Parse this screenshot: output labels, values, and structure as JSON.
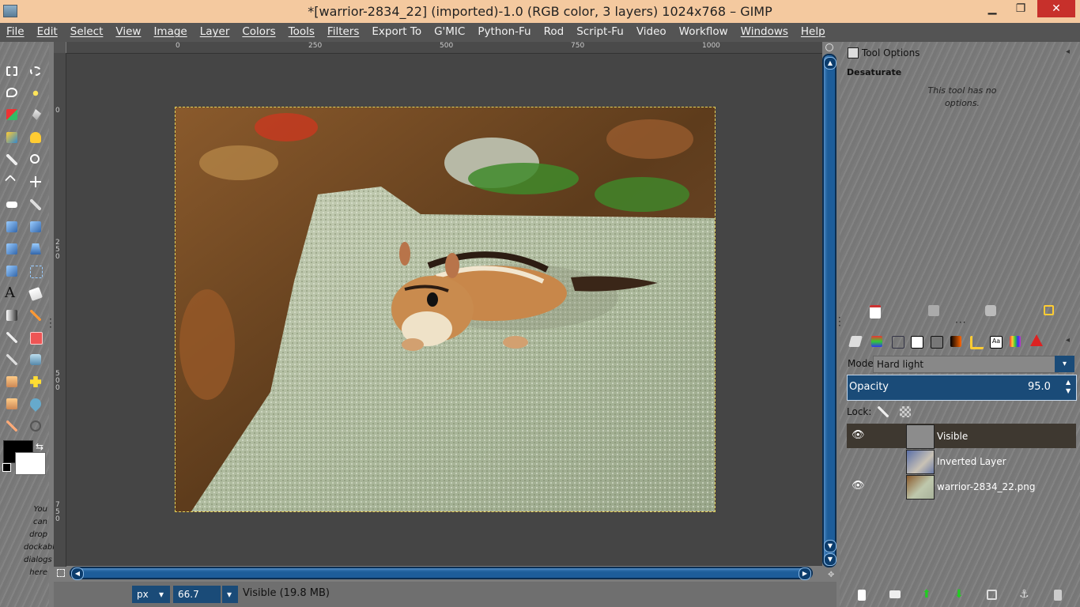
{
  "window": {
    "title": "*[warrior-2834_22] (imported)-1.0 (RGB color, 3 layers) 1024x768 – GIMP",
    "minimize": "▁",
    "maximize": "❐",
    "close": "✕"
  },
  "menubar": {
    "items": [
      "File",
      "Edit",
      "Select",
      "View",
      "Image",
      "Layer",
      "Colors",
      "Tools",
      "Filters",
      "Export To",
      "G'MIC",
      "Python-Fu",
      "Rod",
      "Script-Fu",
      "Video",
      "Workflow",
      "Windows",
      "Help"
    ]
  },
  "ruler": {
    "top_ticks": [
      "0",
      "250",
      "500",
      "750",
      "1000"
    ],
    "left_ticks": [
      "0",
      "250",
      "500",
      "750"
    ]
  },
  "toolbox": {
    "dock_hint": "You can drop dockable dialogs here"
  },
  "statusbar": {
    "unit": "px",
    "zoom": "66.7",
    "status": "Visible (19.8 MB)"
  },
  "tool_options": {
    "title": "Tool Options",
    "tool_name": "Desaturate",
    "note": "This tool has no options."
  },
  "layers": {
    "mode_label": "Mode:",
    "mode_value": "Hard light",
    "opacity_label": "Opacity",
    "opacity_value": "95.0",
    "lock_label": "Lock:",
    "items": [
      {
        "name": "Visible",
        "visible": true,
        "selected": true
      },
      {
        "name": "Inverted Layer",
        "visible": false,
        "selected": false
      },
      {
        "name": "warrior-2834_22.png",
        "visible": true,
        "selected": false
      }
    ]
  },
  "colors": {
    "foreground": "#000000",
    "background": "#ffffff",
    "accent": "#1a4b78",
    "titlebar": "#f4c99f"
  }
}
